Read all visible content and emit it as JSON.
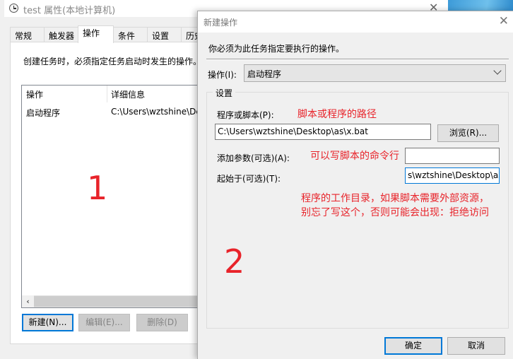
{
  "background_window": {
    "title": "test 属性(本地计算机)",
    "tabs": [
      {
        "label": "常规",
        "active": false
      },
      {
        "label": "触发器",
        "active": false
      },
      {
        "label": "操作",
        "active": true
      },
      {
        "label": "条件",
        "active": false
      },
      {
        "label": "设置",
        "active": false
      },
      {
        "label": "历史",
        "active": false
      }
    ],
    "description": "创建任务时，必须指定任务启动时发生的操作。",
    "list": {
      "columns": [
        "操作",
        "详细信息"
      ],
      "rows": [
        {
          "action": "启动程序",
          "details": "C:\\Users\\wztshine\\Desktop\\as\\x.bat"
        }
      ]
    },
    "annotation_number": "1",
    "buttons": {
      "new": "新建(N)...",
      "edit": "编辑(E)...",
      "delete": "删除(D)"
    }
  },
  "dialog": {
    "title": "新建操作",
    "intro": "你必须为此任务指定要执行的操作。",
    "operation_label": "操作(I):",
    "operation_value": "启动程序",
    "settings_legend": "设置",
    "program_label": "程序或脚本(P):",
    "program_value": "C:\\Users\\wztshine\\Desktop\\as\\x.bat",
    "browse_button": "浏览(R)...",
    "args_label": "添加参数(可选)(A):",
    "args_value": "",
    "start_in_label": "起始于(可选)(T):",
    "start_in_value": "s\\wztshine\\Desktop\\as",
    "ok_button": "确定",
    "cancel_button": "取消",
    "annotation_number": "2"
  },
  "annotations": {
    "program_path": "脚本或程序的路径",
    "args": "可以写脚本的命令行",
    "start_in_line1": "程序的工作目录，如果脚本需要外部资源，",
    "start_in_line2": "别忘了写这个，否则可能会出现：拒绝访问"
  },
  "colors": {
    "annotation": "#e8232a",
    "focus_accent": "#0078d7"
  }
}
